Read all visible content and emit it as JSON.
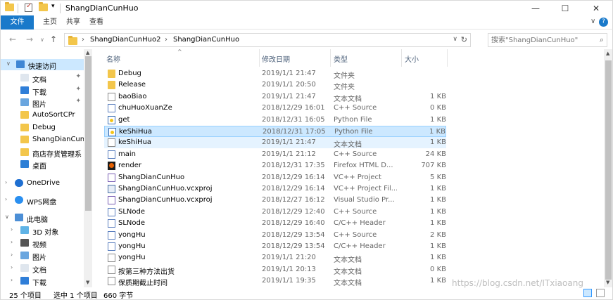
{
  "window": {
    "title": "ShangDianCunHuo",
    "quick_access_dropdown": "▾",
    "minimize": "—",
    "maximize": "☐",
    "close": "✕"
  },
  "ribbon": {
    "tabs": [
      "文件",
      "主页",
      "共享",
      "查看"
    ],
    "expand": "∨",
    "help": "?"
  },
  "nav": {
    "back": "←",
    "forward": "→",
    "recent": "∨",
    "up": "↑",
    "crumbs": [
      "ShangDianCunHuo2",
      "ShangDianCunHuo"
    ],
    "crumb_sep": "›",
    "address_dropdown": "∨",
    "refresh": "↻",
    "search_placeholder": "搜索\"ShangDianCunHuo\"",
    "search_icon": "⌕"
  },
  "sidebar": {
    "items": [
      {
        "label": "快速访问",
        "icon": "star-icon",
        "selected": true,
        "pin": false,
        "expand": "∨"
      },
      {
        "label": "文档",
        "icon": "documents-icon",
        "pin": true
      },
      {
        "label": "下载",
        "icon": "download-icon",
        "pin": true
      },
      {
        "label": "图片",
        "icon": "pictures-icon",
        "pin": true
      },
      {
        "label": "AutoSortCPr",
        "icon": "folder-icon",
        "pin": false
      },
      {
        "label": "Debug",
        "icon": "folder-icon",
        "pin": false
      },
      {
        "label": "ShangDianCunH",
        "icon": "folder-icon",
        "pin": false
      },
      {
        "label": "商店存货管理系",
        "icon": "folder-icon",
        "pin": false
      },
      {
        "label": "桌面",
        "icon": "desktop-icon",
        "pin": false
      },
      {
        "label": "OneDrive",
        "icon": "onedrive-icon",
        "pin": false,
        "expand": "›"
      },
      {
        "label": "WPS网盘",
        "icon": "wps-cloud-icon",
        "pin": false,
        "expand": "›"
      },
      {
        "label": "此电脑",
        "icon": "this-pc-icon",
        "pin": false,
        "expand": "∨"
      },
      {
        "label": "3D 对象",
        "icon": "3d-objects-icon",
        "pin": false,
        "expand": "›"
      },
      {
        "label": "视频",
        "icon": "videos-icon",
        "pin": false,
        "expand": "›"
      },
      {
        "label": "图片",
        "icon": "pictures-icon",
        "pin": false,
        "expand": "›"
      },
      {
        "label": "文档",
        "icon": "documents-icon",
        "pin": false,
        "expand": "›"
      },
      {
        "label": "下载",
        "icon": "download-icon",
        "pin": false,
        "expand": "›"
      }
    ],
    "pin_glyph": "📌"
  },
  "columns": {
    "name": "名称",
    "date": "修改日期",
    "type": "类型",
    "size": "大小",
    "sort_indicator": "^"
  },
  "files": [
    {
      "name": "Debug",
      "date": "2019/1/1 21:47",
      "type": "文件夹",
      "size": "",
      "icon": "folder-icon"
    },
    {
      "name": "Release",
      "date": "2019/1/1 20:50",
      "type": "文件夹",
      "size": "",
      "icon": "folder-icon"
    },
    {
      "name": "baoBiao",
      "date": "2019/1/1 21:47",
      "type": "文本文档",
      "size": "1 KB",
      "icon": "text-file-icon"
    },
    {
      "name": "chuHuoXuanZe",
      "date": "2018/12/29 16:01",
      "type": "C++ Source",
      "size": "0 KB",
      "icon": "cpp-file-icon"
    },
    {
      "name": "get",
      "date": "2018/12/31 16:05",
      "type": "Python File",
      "size": "1 KB",
      "icon": "python-file-icon"
    },
    {
      "name": "keShiHua",
      "date": "2018/12/31 17:05",
      "type": "Python File",
      "size": "1 KB",
      "icon": "python-file-icon",
      "highlight": "selected"
    },
    {
      "name": "keShiHua",
      "date": "2019/1/1 21:47",
      "type": "文本文档",
      "size": "1 KB",
      "icon": "text-file-icon",
      "highlight": "hover"
    },
    {
      "name": "main",
      "date": "2019/1/1 21:12",
      "type": "C++ Source",
      "size": "24 KB",
      "icon": "cpp-file-icon"
    },
    {
      "name": "render",
      "date": "2018/12/31 17:35",
      "type": "Firefox HTML D...",
      "size": "707 KB",
      "icon": "html-file-icon"
    },
    {
      "name": "ShangDianCunHuo",
      "date": "2018/12/29 16:14",
      "type": "VC++ Project",
      "size": "5 KB",
      "icon": "vcproj-icon"
    },
    {
      "name": "ShangDianCunHuo.vcxproj",
      "date": "2018/12/29 16:14",
      "type": "VC++ Project Fil...",
      "size": "1 KB",
      "icon": "vcxproj-filters-icon"
    },
    {
      "name": "ShangDianCunHuo.vcxproj",
      "date": "2018/12/27 16:12",
      "type": "Visual Studio Pr...",
      "size": "1 KB",
      "icon": "vs-project-icon"
    },
    {
      "name": "SLNode",
      "date": "2018/12/29 12:40",
      "type": "C++ Source",
      "size": "1 KB",
      "icon": "cpp-file-icon"
    },
    {
      "name": "SLNode",
      "date": "2018/12/29 16:40",
      "type": "C/C++ Header",
      "size": "1 KB",
      "icon": "header-file-icon"
    },
    {
      "name": "yongHu",
      "date": "2018/12/29 13:54",
      "type": "C++ Source",
      "size": "2 KB",
      "icon": "cpp-file-icon"
    },
    {
      "name": "yongHu",
      "date": "2018/12/29 13:54",
      "type": "C/C++ Header",
      "size": "1 KB",
      "icon": "header-file-icon"
    },
    {
      "name": "yongHu",
      "date": "2019/1/1 21:20",
      "type": "文本文档",
      "size": "1 KB",
      "icon": "text-file-icon"
    },
    {
      "name": "按第三种方法出货",
      "date": "2019/1/1 20:13",
      "type": "文本文档",
      "size": "0 KB",
      "icon": "text-file-icon"
    },
    {
      "name": "保质期截止时间",
      "date": "2019/1/1 19:35",
      "type": "文本文档",
      "size": "1 KB",
      "icon": "text-file-icon"
    }
  ],
  "status": {
    "count": "25 个项目",
    "selected": "选中 1 个项目",
    "size": "660 字节"
  },
  "watermark": "https://blog.csdn.net/ITxiaoang"
}
